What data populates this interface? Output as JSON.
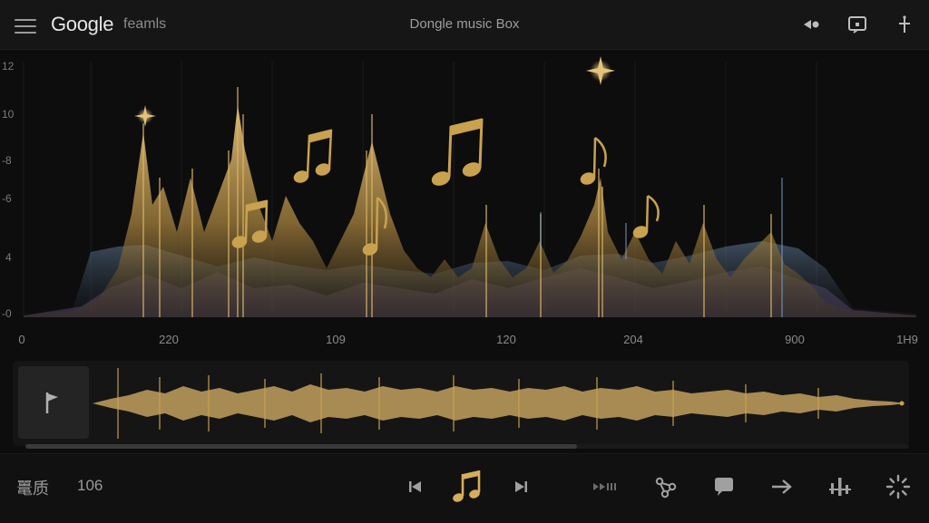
{
  "header": {
    "logo": "Google",
    "workspace": "feamls",
    "title": "Dongle music Box"
  },
  "spectrum": {
    "y_ticks": [
      "12",
      "10",
      "-8",
      "-6",
      "4",
      "-0"
    ],
    "x_ticks": [
      "0",
      "220",
      "109",
      "120",
      "204",
      "900",
      "1H9"
    ]
  },
  "footer": {
    "quality_label": "鼍质",
    "quality_value": "106"
  },
  "colors": {
    "accent_gold": "#c9a24f",
    "background": "#0d0d0d",
    "bar": "#161616"
  },
  "icons": {
    "menu": "menu-icon",
    "speaker": "speaker-icon",
    "cast": "cast-icon",
    "antenna": "antenna-icon",
    "flag": "flag-icon",
    "previous": "skip-previous-icon",
    "music_note": "music-note-icon",
    "next": "skip-next-icon",
    "fast_forward": "fast-forward-icon",
    "share": "share-icon",
    "comment": "comment-icon",
    "arrow": "arrow-right-icon",
    "equalizer": "equalizer-icon",
    "loading": "loading-icon"
  }
}
